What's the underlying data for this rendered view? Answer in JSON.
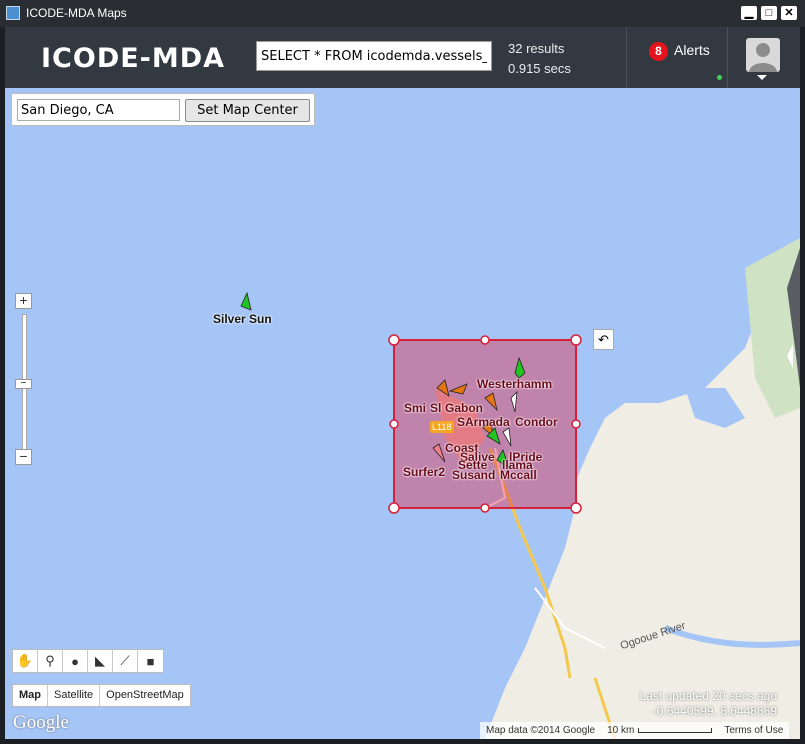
{
  "window": {
    "title": "ICODE-MDA Maps",
    "buttons": [
      "▁",
      "□",
      "✕"
    ]
  },
  "header": {
    "logo": "ICODE-MDA",
    "query": "SELECT * FROM icodemda.vessels_",
    "results_count": "32 results",
    "results_time": "0.915 secs",
    "alerts_count": "8",
    "alerts_label": "Alerts"
  },
  "map_center": {
    "input_value": "San Diego, CA",
    "button_label": "Set Map Center"
  },
  "zoom": {
    "plus": "+",
    "minus": "−",
    "mid": "−"
  },
  "tools": {
    "icons": [
      "hand-icon",
      "marker-icon",
      "circle-icon",
      "polygon-icon",
      "polyline-icon",
      "rectangle-icon"
    ],
    "glyphs": [
      "✋",
      "⚲",
      "●",
      "◣",
      "⟋",
      "■"
    ]
  },
  "map_types": [
    "Map",
    "Satellite",
    "OpenStreetMap"
  ],
  "vessels": [
    {
      "name": "Silver Sun"
    },
    {
      "name": "Westerhamm"
    },
    {
      "name": "Smi"
    },
    {
      "name": "Sl"
    },
    {
      "name": "Gabon"
    },
    {
      "name": "SArmada"
    },
    {
      "name": "Condor"
    },
    {
      "name": "Coast"
    },
    {
      "name": "Salive"
    },
    {
      "name": "lPride"
    },
    {
      "name": "Sette"
    },
    {
      "name": "llama"
    },
    {
      "name": "Susand"
    },
    {
      "name": "Mccall"
    },
    {
      "name": "Surfer2"
    }
  ],
  "road_label": "L118",
  "river_label": "Ogooue River",
  "footer": {
    "last_updated": "Last updated 20 secs ago",
    "coords": "-0.6440599, 8.6448669",
    "map_data": "Map data ©2014 Google",
    "scale": "10 km",
    "terms": "Terms of Use",
    "google": "Google"
  },
  "colors": {
    "header_bg": "#333940",
    "water": "#a5c5f7",
    "land": "#f0ede5",
    "selection_fill": "#e3344e",
    "alert_badge": "#e5141c",
    "vessel_green": "#22c422",
    "vessel_orange": "#e6740f"
  }
}
